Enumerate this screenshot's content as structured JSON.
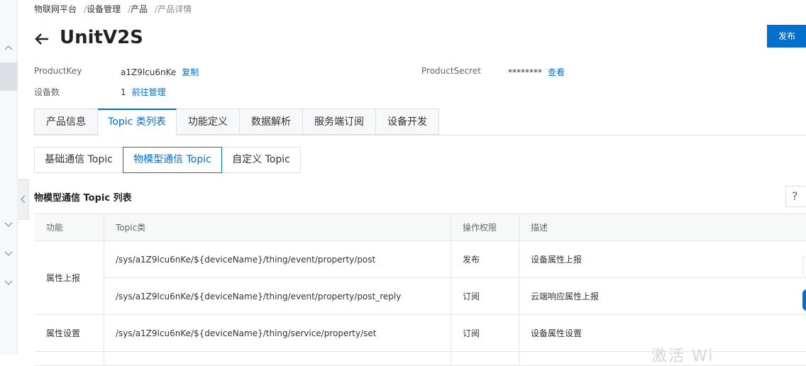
{
  "breadcrumb": [
    "物联网平台",
    "设备管理",
    "产品",
    "产品详情"
  ],
  "header": {
    "title": "UnitV2S",
    "publish_label": "发布"
  },
  "info": {
    "product_key_label": "ProductKey",
    "product_key_value": "a1Z9lcu6nKe",
    "copy_label": "复制",
    "product_secret_label": "ProductSecret",
    "product_secret_value": "********",
    "view_label": "查看",
    "device_count_label": "设备数",
    "device_count_value": "1",
    "manage_label": "前往管理"
  },
  "tabs": [
    "产品信息",
    "Topic 类列表",
    "功能定义",
    "数据解析",
    "服务端订阅",
    "设备开发"
  ],
  "subtabs": [
    "基础通信 Topic",
    "物模型通信 Topic",
    "自定义 Topic"
  ],
  "section": {
    "title": "物模型通信 Topic 列表",
    "help": "?"
  },
  "table": {
    "headers": [
      "功能",
      "Topic类",
      "操作权限",
      "描述"
    ],
    "rows": [
      {
        "group": "属性上报",
        "topic": "/sys/a1Z9lcu6nKe/${deviceName}/thing/event/property/post",
        "permission": "发布",
        "desc": "设备属性上报"
      },
      {
        "group": "",
        "topic": "/sys/a1Z9lcu6nKe/${deviceName}/thing/event/property/post_reply",
        "permission": "订阅",
        "desc": "云端响应属性上报"
      },
      {
        "group": "属性设置",
        "topic": "/sys/a1Z9lcu6nKe/${deviceName}/thing/service/property/set",
        "permission": "订阅",
        "desc": "设备属性设置"
      }
    ]
  },
  "watermark": "激活 Wi",
  "colors": {
    "accent": "#0070cc",
    "border": "#dcdfe3",
    "header_bg": "#f7f8fa"
  }
}
